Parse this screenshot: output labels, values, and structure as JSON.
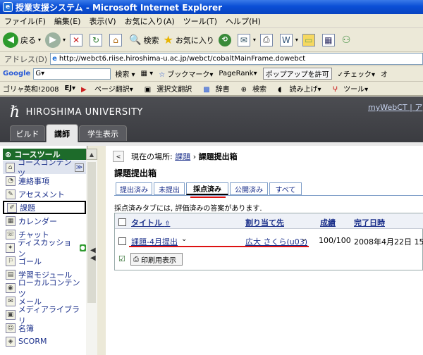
{
  "window": {
    "title": "授業支援システム - Microsoft Internet Explorer"
  },
  "menu": [
    "ファイル(F)",
    "編集(E)",
    "表示(V)",
    "お気に入り(A)",
    "ツール(T)",
    "ヘルプ(H)"
  ],
  "toolbar": {
    "back": "戻る",
    "search": "検索",
    "favorites": "お気に入り"
  },
  "address": {
    "label": "アドレス(D)",
    "url": "http://webct6.riise.hiroshima-u.ac.jp/webct/cobaltMainFrame.dowebct"
  },
  "googlebar": {
    "logo": "Google",
    "input": "G▾",
    "search": "検索",
    "bookmarks": "ブックマーク",
    "pagerank": "PageRank",
    "popup": "ポップアップを許可",
    "check": "チェック",
    "extra": "オ"
  },
  "jpbar": {
    "dict": "ゴリャ英和!2008",
    "ej": "EJ▾",
    "translate": "ページ翻訳▾",
    "select": "選択文翻訳",
    "jisho": "辞書",
    "search": "検索",
    "read": "読み上げ▾",
    "tools": "ツール▾"
  },
  "header": {
    "logo": "HIROSHIMA UNIVERSITY",
    "mywebct": "myWebCT",
    "sep": "|",
    "more": "ア",
    "tabs": [
      "ビルド",
      "講師",
      "学生表示"
    ],
    "active_tab": "講師"
  },
  "sidebar": {
    "title": "コースツール",
    "items": [
      {
        "label": "コースコンテンツ",
        "icon": "home-icon"
      },
      {
        "label": "連絡事項",
        "icon": "announce-icon"
      },
      {
        "label": "アセスメント",
        "icon": "assessment-icon"
      },
      {
        "label": "課題",
        "icon": "assignment-icon"
      },
      {
        "label": "カレンダー",
        "icon": "calendar-icon"
      },
      {
        "label": "チャット",
        "icon": "chat-icon"
      },
      {
        "label": "ディスカッション",
        "icon": "discussion-icon"
      },
      {
        "label": "ゴール",
        "icon": "goal-icon"
      },
      {
        "label": "学習モジュール",
        "icon": "module-icon"
      },
      {
        "label": "ローカルコンテンツ",
        "icon": "local-icon"
      },
      {
        "label": "メール",
        "icon": "mail-icon"
      },
      {
        "label": "メディアライブラリ",
        "icon": "media-icon"
      },
      {
        "label": "名簿",
        "icon": "roster-icon"
      },
      {
        "label": "SCORM",
        "icon": "scorm-icon"
      }
    ]
  },
  "breadcrumb": {
    "prefix": "現在の場所:",
    "link": "課題",
    "sep": "›",
    "current": "課題提出箱"
  },
  "page_title": "課題提出箱",
  "tabs": [
    "提出済み",
    "未提出",
    "採点済み",
    "公開済み",
    "すべて"
  ],
  "active_tab": "採点済み",
  "tab_description": "採点済みタブには, 評価済みの答案があります.",
  "table": {
    "columns": [
      "タイトル",
      "割り当て先",
      "成績",
      "完了日時"
    ],
    "rows": [
      {
        "title": "課題-4月提出",
        "assignee": "広大 さくら(u03)",
        "grade": "100/100",
        "completed": "2008年4月22日 15:"
      }
    ]
  },
  "print_label": "印刷用表示",
  "colors": {
    "title_bar": "#0a4fd6",
    "header_bg": "#3a3b40",
    "sidebar_head": "#1d6b2a",
    "link": "#1a2f8a",
    "annotation_red": "#d11111"
  }
}
